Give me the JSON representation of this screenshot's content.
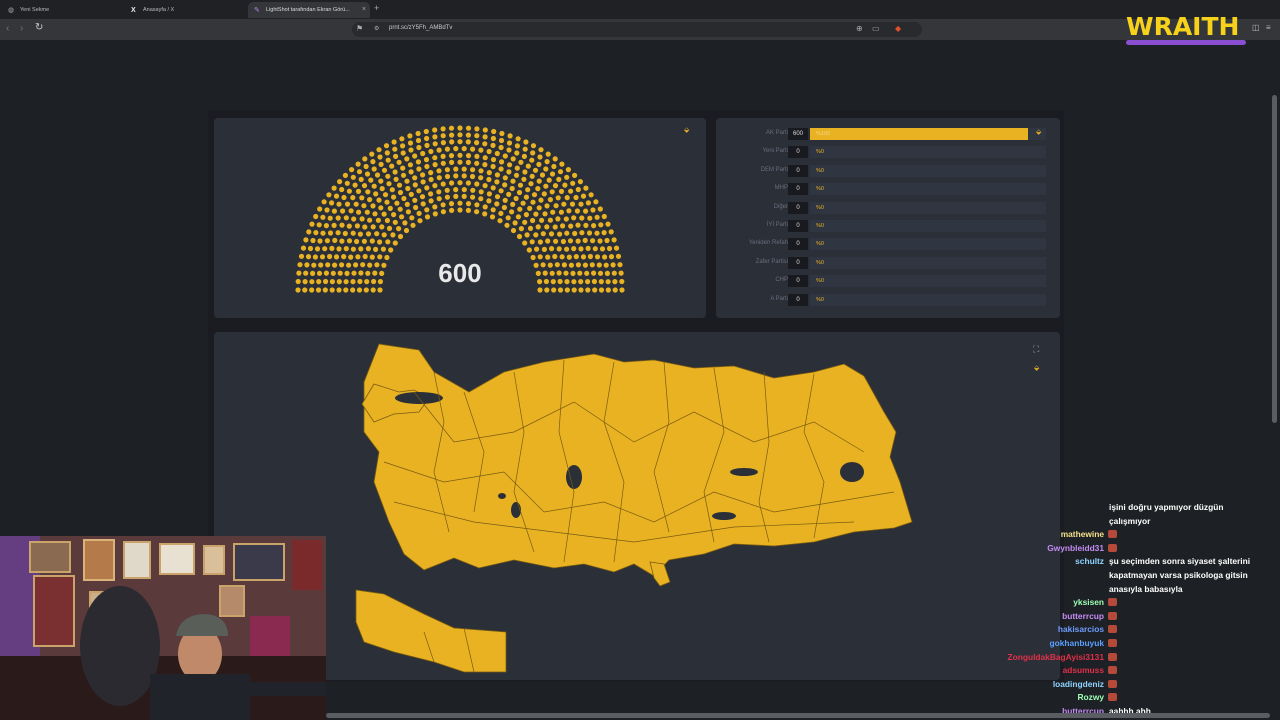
{
  "browser": {
    "tabs": [
      {
        "title": "Yeni Sekme"
      },
      {
        "title": "Anasayfa / X"
      },
      {
        "title": "LightShot tarafından Ekran Görü..."
      }
    ],
    "url": "prnt.sc/zY5Fh_AMBdTv"
  },
  "overlay": {
    "brand": "WRAITH"
  },
  "assembly": {
    "total_seats": "600"
  },
  "parties": [
    {
      "name": "AK Parti",
      "seats": "600",
      "pct": "%100",
      "share": 1.0
    },
    {
      "name": "Yeni Parti",
      "seats": "0",
      "pct": "%0",
      "share": 0
    },
    {
      "name": "DEM Parti",
      "seats": "0",
      "pct": "%0",
      "share": 0
    },
    {
      "name": "MHP",
      "seats": "0",
      "pct": "%0",
      "share": 0
    },
    {
      "name": "Diğer",
      "seats": "0",
      "pct": "%0",
      "share": 0
    },
    {
      "name": "İYİ Parti",
      "seats": "0",
      "pct": "%0",
      "share": 0
    },
    {
      "name": "Yeniden Refah",
      "seats": "0",
      "pct": "%0",
      "share": 0
    },
    {
      "name": "Zafer Partisi",
      "seats": "0",
      "pct": "%0",
      "share": 0
    },
    {
      "name": "CHP",
      "seats": "0",
      "pct": "%0",
      "share": 0
    },
    {
      "name": "A Parti",
      "seats": "0",
      "pct": "%0",
      "share": 0
    }
  ],
  "colors": {
    "party_fill": "#e8b223"
  },
  "chat": {
    "messages": [
      {
        "user": "",
        "color": "#ffffff",
        "text": "işini doğru yapmıyor düzgün"
      },
      {
        "user": "",
        "color": "#ffffff",
        "text": "çalışmıyor"
      },
      {
        "user": "mathewine",
        "color": "#f2e08b",
        "text": ""
      },
      {
        "user": "Gwynbleidd31",
        "color": "#c48bf5",
        "text": ""
      },
      {
        "user": "schultz",
        "color": "#8fd3ff",
        "text": "şu seçimden sonra siyaset şalterini"
      },
      {
        "user": "",
        "color": "#ffffff",
        "text": "kapatmayan varsa psikologa gitsin"
      },
      {
        "user": "",
        "color": "#ffffff",
        "text": "anasıyla babasıyla"
      },
      {
        "user": "yksisen",
        "color": "#9cffb5",
        "text": ""
      },
      {
        "user": "butterrcup",
        "color": "#c58cf5",
        "text": ""
      },
      {
        "user": "hakisarcios",
        "color": "#6e9cff",
        "text": ""
      },
      {
        "user": "gokhanbuyuk",
        "color": "#5aa0ff",
        "text": ""
      },
      {
        "user": "ZonguldakBagAyisi3131",
        "color": "#e0304a",
        "text": ""
      },
      {
        "user": "adsumuss",
        "color": "#e0304a",
        "text": ""
      },
      {
        "user": "loadingdeniz",
        "color": "#8fd3ff",
        "text": ""
      },
      {
        "user": "Rozwy",
        "color": "#9cffb5",
        "text": ""
      },
      {
        "user": "butterrcup",
        "color": "#c58cf5",
        "text": "aahhh ahh"
      }
    ]
  }
}
